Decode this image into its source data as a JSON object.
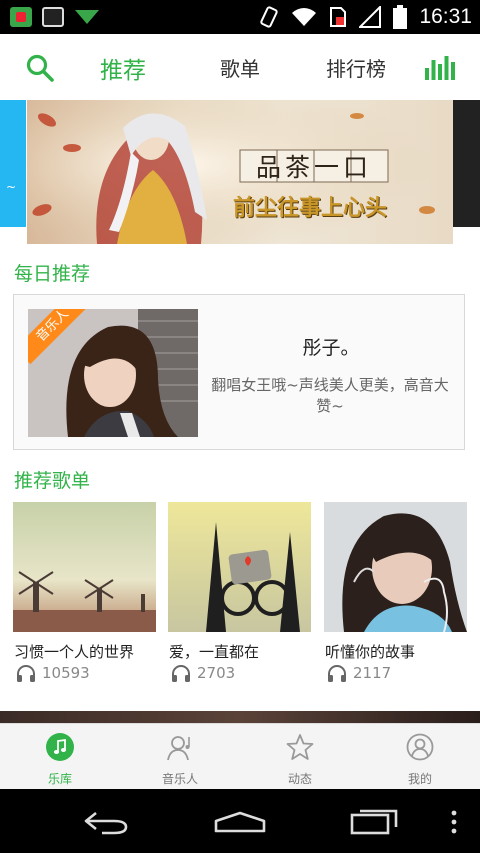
{
  "status_bar": {
    "time": "16:31",
    "icons": [
      "app-icon",
      "image-icon",
      "download-icon",
      "vibrate-icon",
      "wifi-icon",
      "sim-icon",
      "signal-icon",
      "battery-icon"
    ]
  },
  "top_nav": {
    "tabs": [
      {
        "label": "推荐",
        "active": true
      },
      {
        "label": "歌单",
        "active": false
      },
      {
        "label": "排行榜",
        "active": false
      }
    ],
    "search_icon": "search-icon",
    "equalizer_icon": "equalizer-icon"
  },
  "banner": {
    "title_text": "品茶一口",
    "subtitle_text": "前尘往事上心头"
  },
  "daily": {
    "section_title": "每日推荐",
    "badge": "音乐人",
    "name": "彤子。",
    "description": "翻唱女王哦~声线美人更美，高音大赞~"
  },
  "playlists": {
    "section_title": "推荐歌单",
    "items": [
      {
        "title": "习惯一个人的世界",
        "count": "10593"
      },
      {
        "title": "爱，一直都在",
        "count": "2703"
      },
      {
        "title": "听懂你的故事",
        "count": "2117"
      }
    ]
  },
  "bottom_tabs": [
    {
      "label": "乐库",
      "active": true
    },
    {
      "label": "音乐人",
      "active": false
    },
    {
      "label": "动态",
      "active": false
    },
    {
      "label": "我的",
      "active": false
    }
  ],
  "colors": {
    "accent": "#32b34a",
    "badge": "#ff8a1a"
  }
}
